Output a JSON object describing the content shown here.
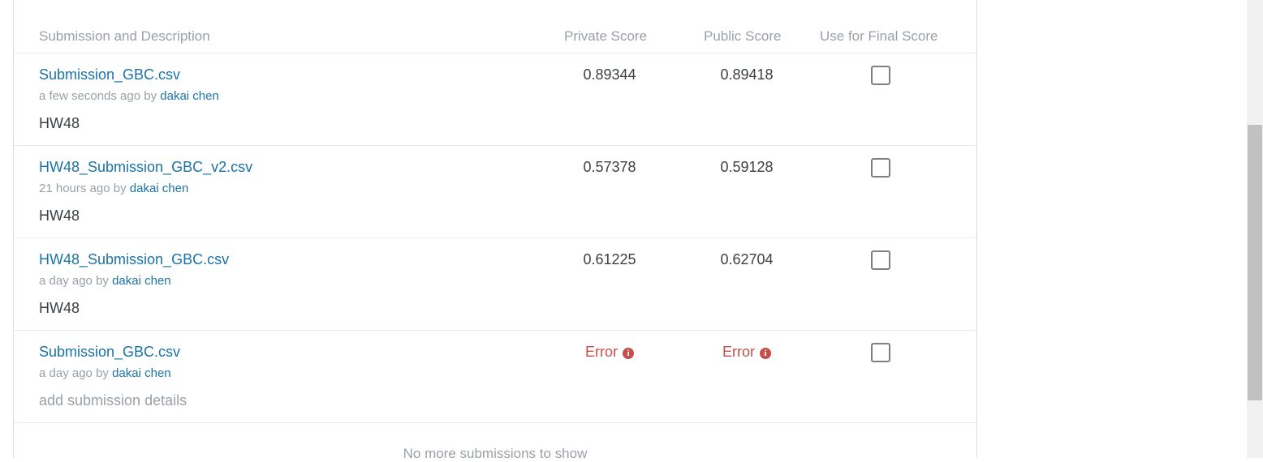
{
  "table": {
    "headers": {
      "description": "Submission and Description",
      "private": "Private Score",
      "public": "Public Score",
      "final": "Use for Final Score"
    },
    "rows": [
      {
        "filename": "Submission_GBC.csv",
        "time": "a few seconds ago",
        "by": "by",
        "user": "dakai chen",
        "description": "HW48",
        "private": "0.89344",
        "public": "0.89418",
        "selected": false
      },
      {
        "filename": "HW48_Submission_GBC_v2.csv",
        "time": "21 hours ago",
        "by": "by",
        "user": "dakai chen",
        "description": "HW48",
        "private": "0.57378",
        "public": "0.59128",
        "selected": false
      },
      {
        "filename": "HW48_Submission_GBC.csv",
        "time": "a day ago",
        "by": "by",
        "user": "dakai chen",
        "description": "HW48",
        "private": "0.61225",
        "public": "0.62704",
        "selected": false
      },
      {
        "filename": "Submission_GBC.csv",
        "time": "a day ago",
        "by": "by",
        "user": "dakai chen",
        "description": "add submission details",
        "private": "Error",
        "public": "Error",
        "selected": false
      }
    ],
    "footer": "No more submissions to show"
  },
  "icons": {
    "error_info": "info-icon",
    "info_glyph": "i"
  },
  "colors": {
    "link": "#1a73a8",
    "error": "#c5504b",
    "muted": "#9aa0a6"
  }
}
